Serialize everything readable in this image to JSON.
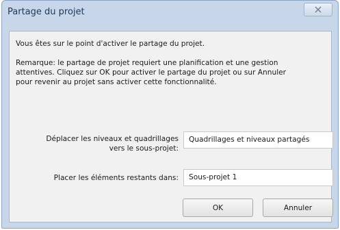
{
  "dialog": {
    "title": "Partage du projet",
    "close_glyph": "X",
    "intro": "Vous êtes sur le point d'activer le partage du projet.",
    "remark_line1": "Remarque: le partage de projet requiert une planification et une gestion",
    "remark_line2": "attentives. Cliquez sur OK pour activer le partage du projet ou sur Annuler",
    "remark_line3": "pour revenir au projet sans activer cette fonctionnalité.",
    "move_label_line1": "Déplacer les niveaux et quadrillages",
    "move_label_line2": "vers le sous-projet:",
    "move_value": "Quadrillages et niveaux partagés",
    "place_label": "Placer les éléments restants dans:",
    "place_value": "Sous-projet 1",
    "ok_label": "OK",
    "cancel_label": "Annuler"
  }
}
